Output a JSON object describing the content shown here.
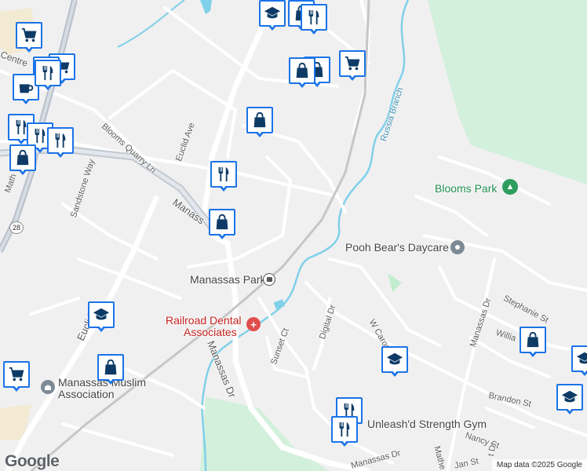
{
  "map": {
    "streets": [
      {
        "id": "centreville",
        "text": "Centre"
      },
      {
        "id": "blooms-quarry",
        "text": "Blooms Quarry Ln"
      },
      {
        "id": "euclid-ave",
        "text": "Euclid Ave"
      },
      {
        "id": "sandstone",
        "text": "Sandstone Way"
      },
      {
        "id": "manassas-top",
        "text": "Manass"
      },
      {
        "id": "route-28",
        "text": "28"
      },
      {
        "id": "euclid-lower",
        "text": "Euclid"
      },
      {
        "id": "manassas-dr",
        "text": "Manassas Dr"
      },
      {
        "id": "sunset-ct",
        "text": "Sunset Ct"
      },
      {
        "id": "digital-dr",
        "text": "Digital Dr"
      },
      {
        "id": "w-caron",
        "text": "W Caron"
      },
      {
        "id": "manassas-dr-east",
        "text": "Manassas Dr"
      },
      {
        "id": "stephanie-st",
        "text": "Stephanie St"
      },
      {
        "id": "william",
        "text": "Willia"
      },
      {
        "id": "brandon-st",
        "text": "Brandon St"
      },
      {
        "id": "nancy-st",
        "text": "Nancy St"
      },
      {
        "id": "manassas-dr-south",
        "text": "Manassas Dr"
      },
      {
        "id": "jan-st",
        "text": "Jan St"
      },
      {
        "id": "matthew",
        "text": "Mathe"
      },
      {
        "id": "russia-branch",
        "text": "Russia Branch"
      },
      {
        "id": "mat-left",
        "text": "Math"
      },
      {
        "id": "ct-letter",
        "text": "t Dr"
      }
    ],
    "pois": [
      {
        "id": "blooms-park",
        "text": "Blooms Park"
      },
      {
        "id": "pooh-bear",
        "text": "Pooh Bear's Daycare"
      },
      {
        "id": "manassas-park",
        "text": "Manassas Park"
      },
      {
        "id": "railroad-dental",
        "line1": "Railroad Dental",
        "line2": "Associates"
      },
      {
        "id": "muslim-assoc",
        "line1": "Manassas Muslim",
        "line2": "Association"
      },
      {
        "id": "strength-gym",
        "text": "Unleash'd Strength Gym"
      }
    ],
    "markers": [
      {
        "icon": "school-icon"
      },
      {
        "icon": "shopping-bag-icon"
      },
      {
        "icon": "restaurant-icon"
      },
      {
        "icon": "shopping-bag-icon"
      },
      {
        "icon": "shopping-bag-icon"
      },
      {
        "icon": "shopping-cart-icon"
      },
      {
        "icon": "shopping-bag-icon"
      },
      {
        "icon": "shopping-cart-icon"
      },
      {
        "icon": "shopping-cart-icon"
      },
      {
        "icon": "shopping-cart-icon"
      },
      {
        "icon": "coffee-icon"
      },
      {
        "icon": "restaurant-icon"
      },
      {
        "icon": "restaurant-icon"
      },
      {
        "icon": "restaurant-icon"
      },
      {
        "icon": "shopping-bag-icon"
      },
      {
        "icon": "restaurant-icon"
      },
      {
        "icon": "restaurant-icon"
      },
      {
        "icon": "shopping-bag-icon"
      },
      {
        "icon": "school-icon"
      },
      {
        "icon": "shopping-bag-icon"
      },
      {
        "icon": "shopping-cart-icon"
      },
      {
        "icon": "school-icon"
      },
      {
        "icon": "shopping-bag-icon"
      },
      {
        "icon": "school-icon"
      },
      {
        "icon": "school-icon"
      },
      {
        "icon": "restaurant-icon"
      },
      {
        "icon": "restaurant-icon"
      }
    ],
    "google_logo": "Google",
    "attribution": "Map data ©2025 Google"
  },
  "colors": {
    "marker_border": "#1a73e8",
    "marker_icon": "#0d3b66",
    "park": "#d3f0dd",
    "water": "#7fd0e8",
    "road": "#ffffff",
    "highway": "#b8c0cc"
  }
}
